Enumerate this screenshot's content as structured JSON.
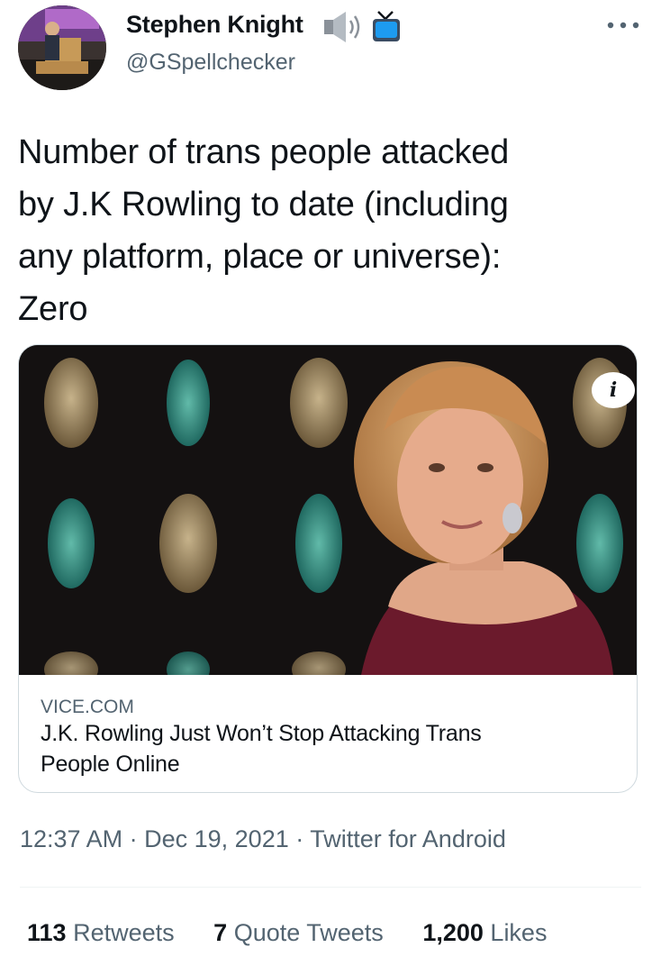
{
  "user": {
    "display_name": "Stephen Knight",
    "handle": "@GSpellchecker",
    "name_emojis": [
      "speaker-icon",
      "television-icon"
    ]
  },
  "tweet": {
    "text": "Number of trans people attacked\nby J.K Rowling to date (including\nany platform, place or universe):\nZero"
  },
  "card": {
    "domain": "VICE.COM",
    "title": "J.K. Rowling Just Won’t Stop Attacking Trans\nPeople Online",
    "info_label": "i"
  },
  "meta": {
    "time": "12:37 AM",
    "date": "Dec 19, 2021",
    "source": "Twitter for Android",
    "separator": "·"
  },
  "stats": {
    "retweets_count": "113",
    "retweets_label": "Retweets",
    "quotes_count": "7",
    "quotes_label": "Quote Tweets",
    "likes_count": "1,200",
    "likes_label": "Likes"
  },
  "colors": {
    "text": "#0f1419",
    "secondary": "#536471",
    "border": "#cfd9de",
    "tv_blue": "#1d9bf0"
  }
}
